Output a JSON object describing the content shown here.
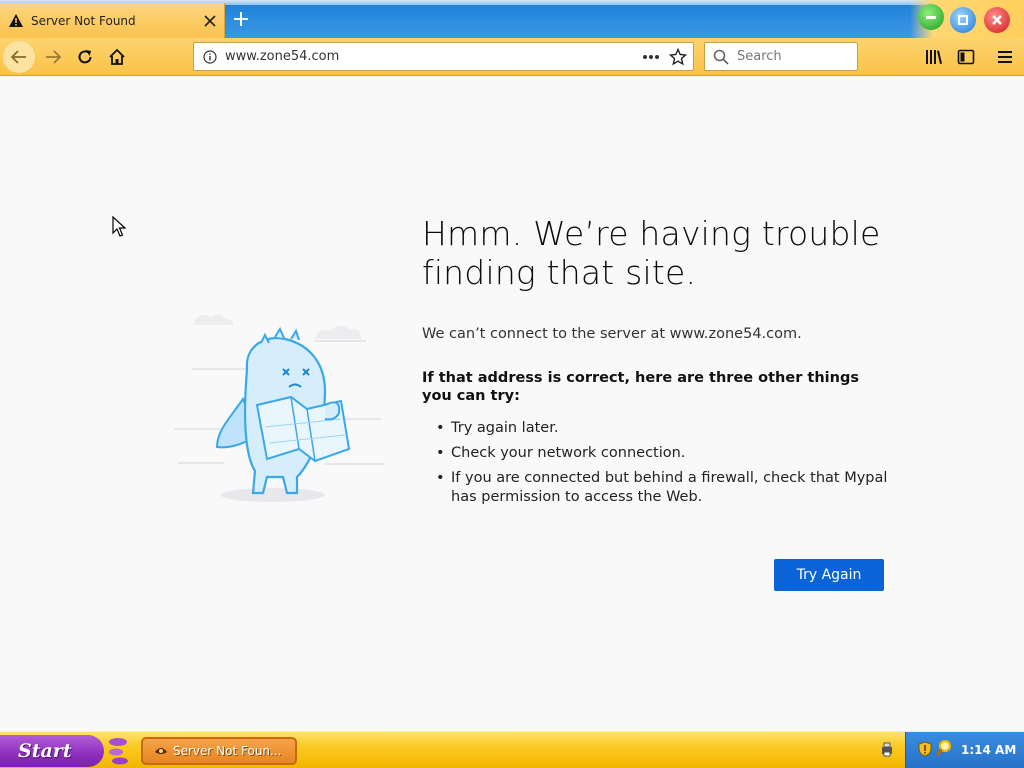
{
  "tab": {
    "title": "Server Not Found"
  },
  "navbar": {
    "url": "www.zone54.com",
    "search_placeholder": "Search"
  },
  "error_page": {
    "heading": "Hmm. We’re having trouble finding that site.",
    "description": "We can’t connect to the server at www.zone54.com.",
    "advice_heading": "If that address is correct, here are three other things you can try:",
    "tips": [
      "Try again later.",
      "Check your network connection.",
      "If you are connected but behind a firewall, check that Mypal has permission to access the Web."
    ],
    "button_label": "Try Again"
  },
  "taskbar": {
    "start_label": "Start",
    "task_label": "Server Not Foun...",
    "clock": "1:14 AM"
  },
  "colors": {
    "accent": "#0a63d7",
    "toolbar": "#fbc248",
    "tabstrip": "#2f8fe0",
    "start": "#8e2fbf"
  }
}
